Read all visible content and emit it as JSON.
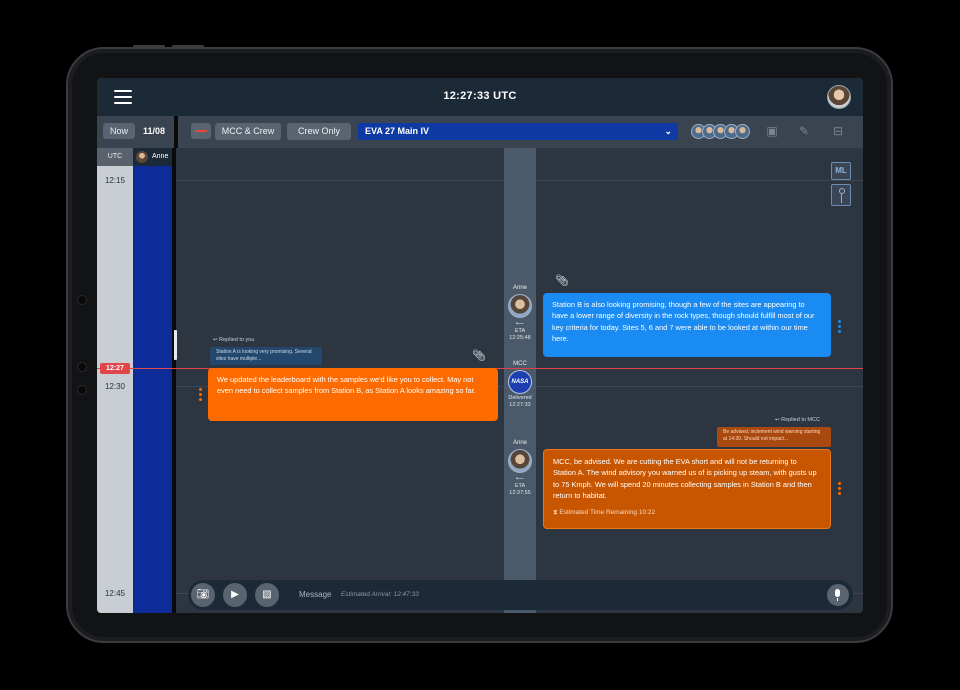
{
  "header": {
    "clock": "12:27:33 UTC"
  },
  "toolbar": {
    "now_label": "Now",
    "date": "11/08",
    "filter_all": "MCC & Crew",
    "filter_crew": "Crew Only",
    "channel": "EVA 27 Main IV"
  },
  "timeline": {
    "utc_label": "UTC",
    "crew_label": "Anne",
    "times": [
      "12:15",
      "12:30",
      "12:45"
    ],
    "now_marker": "12:27"
  },
  "side_tools": {
    "ml_label": "ML"
  },
  "messages": [
    {
      "sender": "Anne",
      "eta_label": "ETA",
      "time": "12:25:48",
      "text": "Station B is also looking promising, though a few of the sites are appearing to have a lower range of diversity in the rock types, though should fulfill most of our key criteria for today. Sites 5, 6 and 7 were able to be looked at within our time here."
    },
    {
      "sender": "MCC",
      "status": "Delivered",
      "time": "12:27:33",
      "avatar_text": "NASA",
      "reply_label": "Replied to you",
      "reply_quote": "Station A is looking very promising. Several sites have multiple...",
      "text": "We updated the leaderboard with the samples we'd like you to collect. May not even need to collect samples from Station B, as Station A looks amazing so far."
    },
    {
      "sender": "Anne",
      "eta_label": "ETA",
      "time": "12:37:55",
      "reply_label": "Replied to MCC",
      "reply_quote": "Be advised, inclement wind warning starting at 14:30. Should not impact...",
      "text": "MCC, be advised. We are cutting the EVA short and will not be returning to Station A. The wind advisory you warned us of is picking up steam, with gusts up to 75 Kmph. We will spend 20 minutes collecting samples in Station B and then return to habitat.",
      "estimate": "Estimated Time Remaining 10:22"
    }
  ],
  "composer": {
    "placeholder": "Message",
    "eta_hint": "Estimated Arrival: 12:47:33"
  },
  "colors": {
    "accent_blue": "#1a8bf2",
    "accent_orange": "#fc6a00",
    "now_line": "#e0454a",
    "channel_bg": "#0f3aa3"
  },
  "icons": [
    "menu-icon",
    "avatar",
    "record-icon",
    "notes-icon",
    "edit-icon",
    "archive-icon",
    "paperclip-icon",
    "camera-icon",
    "video-icon",
    "image-icon",
    "microphone-icon",
    "reply-icon",
    "hourglass-icon",
    "chevron-down-icon",
    "kebab-menu-icon"
  ]
}
